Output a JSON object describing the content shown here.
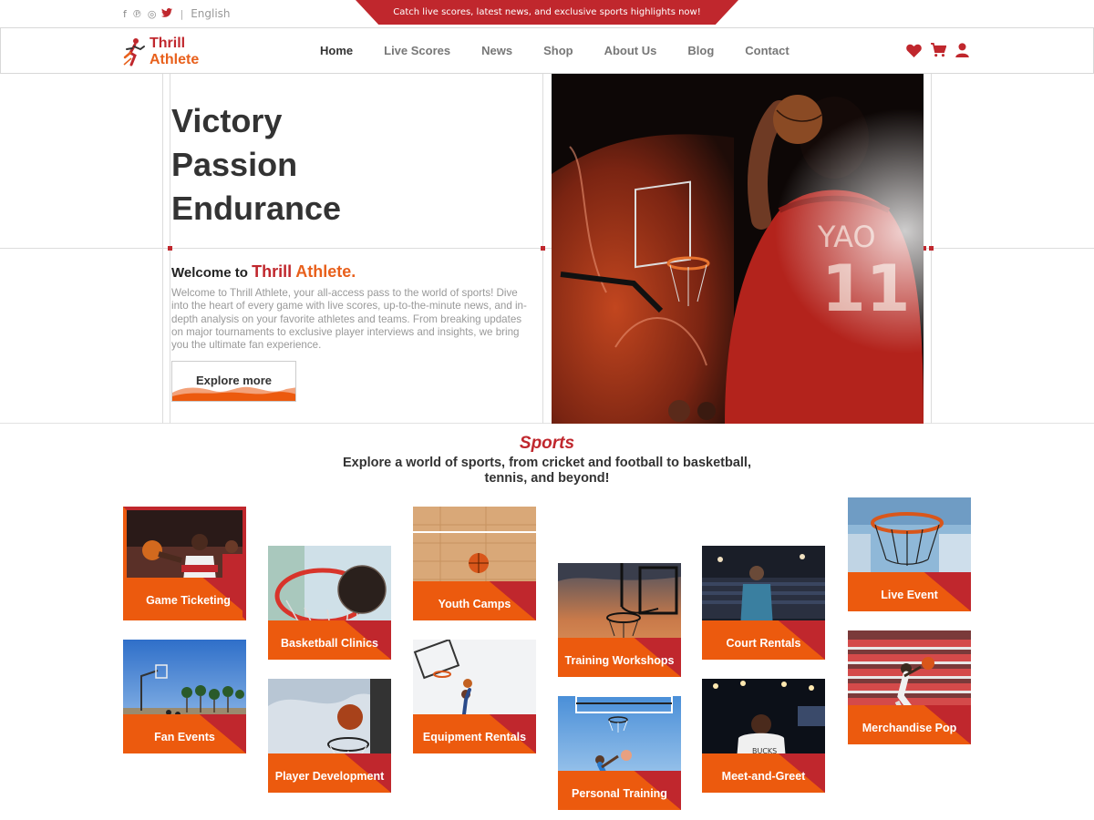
{
  "topbar": {
    "language": "English",
    "announcement": "Catch live scores, latest news, and exclusive sports highlights now!",
    "socials": [
      "facebook-icon",
      "pinterest-icon",
      "instagram-icon",
      "twitter-icon"
    ]
  },
  "header": {
    "logo_line1": "Thrill",
    "logo_line2": "Athlete",
    "nav": [
      "Home",
      "Live Scores",
      "News",
      "Shop",
      "About Us",
      "Blog",
      "Contact"
    ],
    "active": "Home",
    "icons": [
      "heart-icon",
      "cart-icon",
      "user-icon"
    ]
  },
  "hero": {
    "line1": "Victory",
    "line2": "Passion",
    "line3": "Endurance",
    "welcome_prefix": "Welcome to",
    "welcome_brand1": "Thrill",
    "welcome_brand2": "Athlete.",
    "intro": "Welcome to Thrill Athlete, your all-access pass to the world of sports! Dive into the heart of every game with live scores, up-to-the-minute news, and in-depth analysis on your favorite athletes and teams. From breaking updates on major tournaments to exclusive player interviews and insights, we bring you the ultimate fan experience.",
    "cta": "Explore more"
  },
  "sports": {
    "title": "Sports",
    "subtitle": "Explore a world of sports, from cricket and football to basketball, tennis, and beyond!",
    "cards": [
      "Game Ticketing",
      "Fan Events",
      "Basketball Clinics",
      "Player Development",
      "Youth Camps",
      "Equipment Rentals",
      "Training Workshops",
      "Personal Training",
      "Court Rentals",
      "Meet-and-Greet",
      "Live Event",
      "Merchandise Pop"
    ]
  },
  "colors": {
    "brand_red": "#c0272d",
    "brand_orange": "#ec5a0e"
  }
}
